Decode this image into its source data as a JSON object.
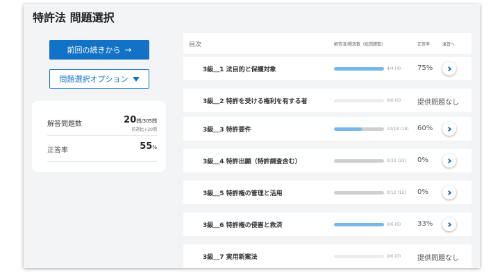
{
  "page": {
    "title": "特許法 問題選択"
  },
  "buttons": {
    "resume": {
      "label": "前回の続きから",
      "icon": "arrow-right-icon",
      "arrow": "→"
    },
    "options": {
      "label": "問題選択オプション",
      "icon": "filter-icon"
    }
  },
  "stats": {
    "answered": {
      "label": "解答問題数",
      "value": "20",
      "unit": "問",
      "total": "/305問",
      "sub": "前週比+20問"
    },
    "accuracy": {
      "label": "正答率",
      "value": "55",
      "unit": "%"
    }
  },
  "list": {
    "header": {
      "toc": "目次",
      "progress": "解答済/開放数（総問題数）",
      "rate": "正答率",
      "practice": "演習へ"
    },
    "rows": [
      {
        "name": "3級＿1 法目的と保護対象",
        "progress": 1.0,
        "count": "4/4 (4)",
        "rate": "75%",
        "has_button": true
      },
      {
        "name": "3級＿2 特許を受ける権利を有する者",
        "progress": 0,
        "count": "0/0 (0)",
        "rate": "提供問題なし",
        "has_button": false
      },
      {
        "name": "3級＿3 特許要件",
        "progress": 0.56,
        "count": "10/18 (18)",
        "rate": "60%",
        "has_button": true
      },
      {
        "name": "3級＿4 特許出願（特許調査含む）",
        "progress": 0,
        "count": "0/33 (33)",
        "rate": "0%",
        "has_button": true
      },
      {
        "name": "3級＿5 特許権の管理と活用",
        "progress": 0,
        "count": "0/12 (12)",
        "rate": "0%",
        "has_button": true
      },
      {
        "name": "3級＿6 特許権の侵害と救済",
        "progress": 1.0,
        "count": "6/6 (6)",
        "rate": "33%",
        "has_button": true
      },
      {
        "name": "3級＿7 実用新案法",
        "progress": 0,
        "count": "0/0 (0)",
        "rate": "提供問題なし",
        "has_button": false
      }
    ]
  },
  "colors": {
    "accent": "#1272c7",
    "progress_fill": "#76b8e8"
  }
}
